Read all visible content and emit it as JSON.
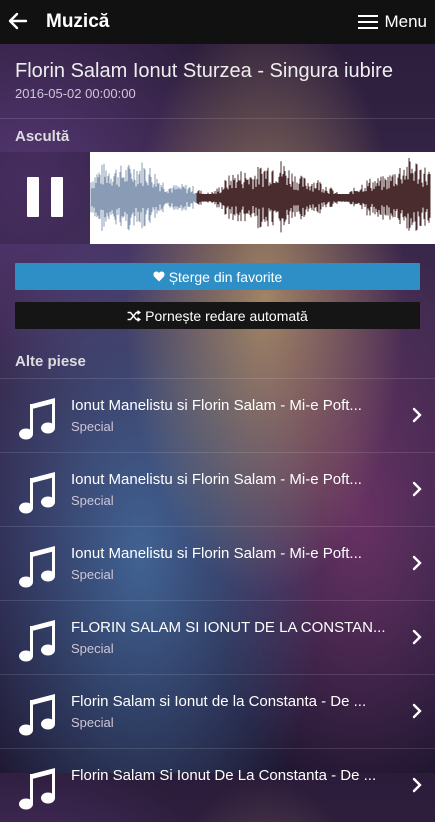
{
  "header": {
    "title": "Muzică",
    "menu_label": "Menu"
  },
  "song": {
    "title": "Florin Salam Ionut Sturzea - Singura iubire",
    "date": "2016-05-02 00:00:00"
  },
  "listen_label": "Ascultă",
  "player": {
    "state": "playing",
    "progress": 0.31
  },
  "buttons": {
    "favorite": "Șterge din favorite",
    "autoplay": "Pornește redare automată"
  },
  "other_label": "Alte piese",
  "tracks": [
    {
      "title": "Ionut Manelistu si Florin Salam - Mi-e Poft...",
      "sub": "Special"
    },
    {
      "title": "Ionut Manelistu si Florin Salam - Mi-e Poft...",
      "sub": "Special"
    },
    {
      "title": "Ionut Manelistu si Florin Salam - Mi-e Poft...",
      "sub": "Special"
    },
    {
      "title": "FLORIN SALAM SI IONUT DE LA CONSTAN...",
      "sub": "Special"
    },
    {
      "title": "Florin Salam si Ionut de la Constanta - De ...",
      "sub": "Special"
    },
    {
      "title": "Florin Salam Si Ionut De La Constanta - De ...",
      "sub": ""
    }
  ],
  "colors": {
    "favorite_button": "#2e8fc6",
    "autoplay_button": "#151515",
    "topbar": "#111111",
    "waveform_played": "#8a9bb5",
    "waveform_remaining": "#4a2c2e"
  }
}
